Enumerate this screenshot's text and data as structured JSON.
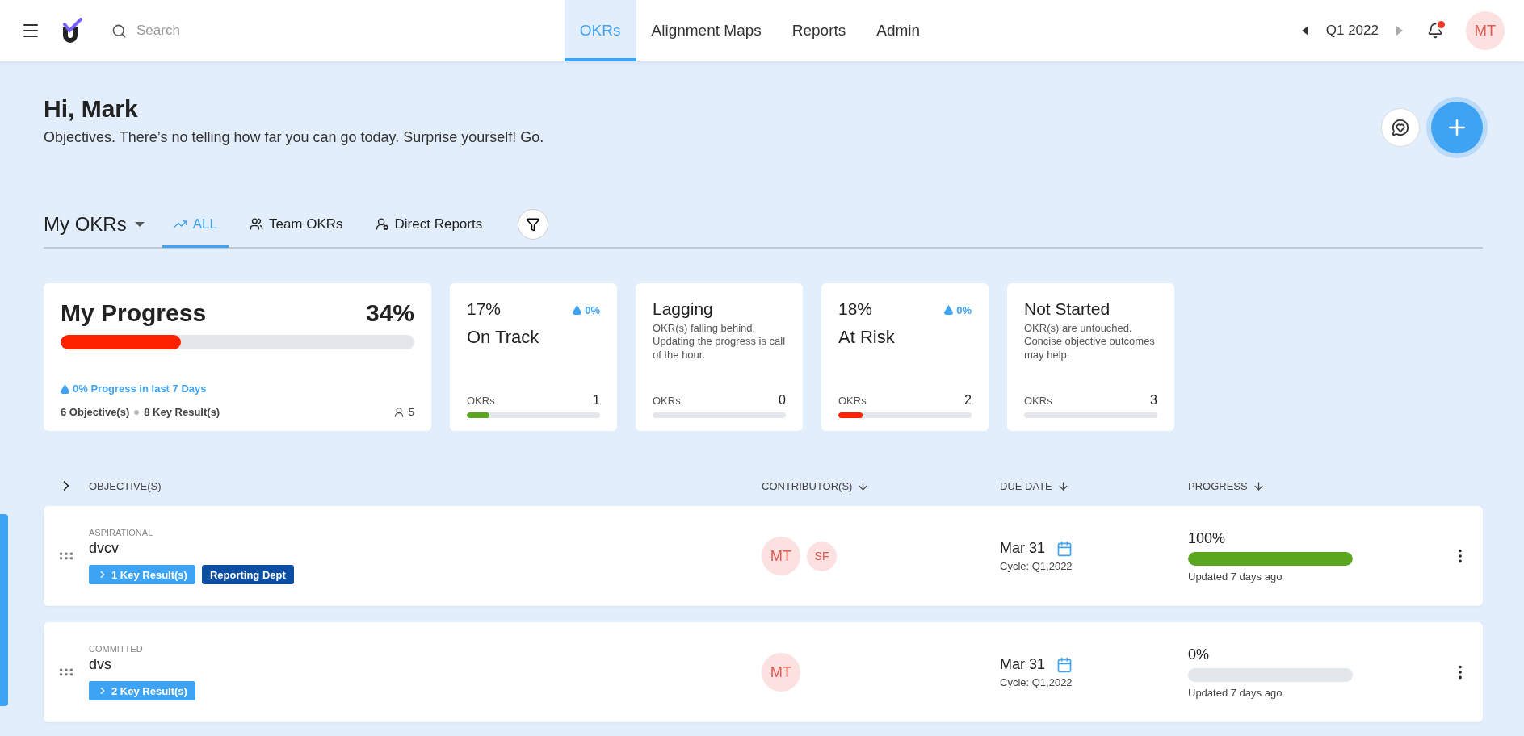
{
  "topbar": {
    "search": {
      "placeholder": "Search"
    },
    "nav": [
      {
        "label": "OKRs",
        "selected": true
      },
      {
        "label": "Alignment Maps",
        "selected": false
      },
      {
        "label": "Reports",
        "selected": false
      },
      {
        "label": "Admin",
        "selected": false
      }
    ],
    "period": "Q1 2022",
    "notifications_unread": true,
    "avatar": "MT"
  },
  "greeting": {
    "title": "Hi, Mark",
    "subtitle": "Objectives. There’s no telling how far you can go today. Surprise yourself! Go."
  },
  "view": {
    "title": "My OKRs",
    "tabs": [
      {
        "label": "ALL",
        "kind": "all",
        "selected": true
      },
      {
        "label": "Team OKRs",
        "kind": "team",
        "selected": false
      },
      {
        "label": "Direct Reports",
        "kind": "reports",
        "selected": false
      }
    ]
  },
  "progress_card": {
    "title": "My Progress",
    "percent": "34%",
    "level": 0.34,
    "change": "0% Progress in last 7 Days",
    "objectives": "6 Objective(s)",
    "key_results": "8 Key Result(s)",
    "members": "5"
  },
  "status_cards": [
    {
      "kind": "percent",
      "percent": "17%",
      "change": "0%",
      "title": "On Track",
      "label": "OKRs",
      "count": "1",
      "level": 0.17,
      "color": "#5aa61e"
    },
    {
      "kind": "description",
      "title": "Lagging",
      "description": "OKR(s) falling behind. Updating the progress is call of the hour.",
      "label": "OKRs",
      "count": "0"
    },
    {
      "kind": "percent",
      "percent": "18%",
      "change": "0%",
      "title": "At Risk",
      "label": "OKRs",
      "count": "2",
      "level": 0.18,
      "color": "#ff2200"
    },
    {
      "kind": "description",
      "title": "Not Started",
      "description": "OKR(s) are untouched. Concise objective outcomes may help.",
      "label": "OKRs",
      "count": "3"
    }
  ],
  "table": {
    "columns": [
      {
        "label": "OBJECTIVE(S)",
        "sortable": false
      },
      {
        "label": "CONTRIBUTOR(S)",
        "sortable": true
      },
      {
        "label": "DUE DATE",
        "sortable": true
      },
      {
        "label": "PROGRESS",
        "sortable": true
      }
    ],
    "rows": [
      {
        "type": "ASPIRATIONAL",
        "name": "dvcv",
        "tags": [
          {
            "kind": "key-results",
            "label": "1 Key Result(s)"
          },
          {
            "kind": "team",
            "label": "Reporting Dept"
          }
        ],
        "contributors": [
          "MT",
          "SF"
        ],
        "due": "Mar 31",
        "cycle": "Cycle: Q1,2022",
        "progress": "100%",
        "level": 1,
        "updated": "Updated 7 days ago"
      },
      {
        "type": "COMMITTED",
        "name": "dvs",
        "tags": [
          {
            "kind": "key-results",
            "label": "2 Key Result(s)"
          }
        ],
        "contributors": [
          "MT"
        ],
        "due": "Mar 31",
        "cycle": "Cycle: Q1,2022",
        "progress": "0%",
        "updated": "Updated 7 days ago"
      }
    ]
  }
}
